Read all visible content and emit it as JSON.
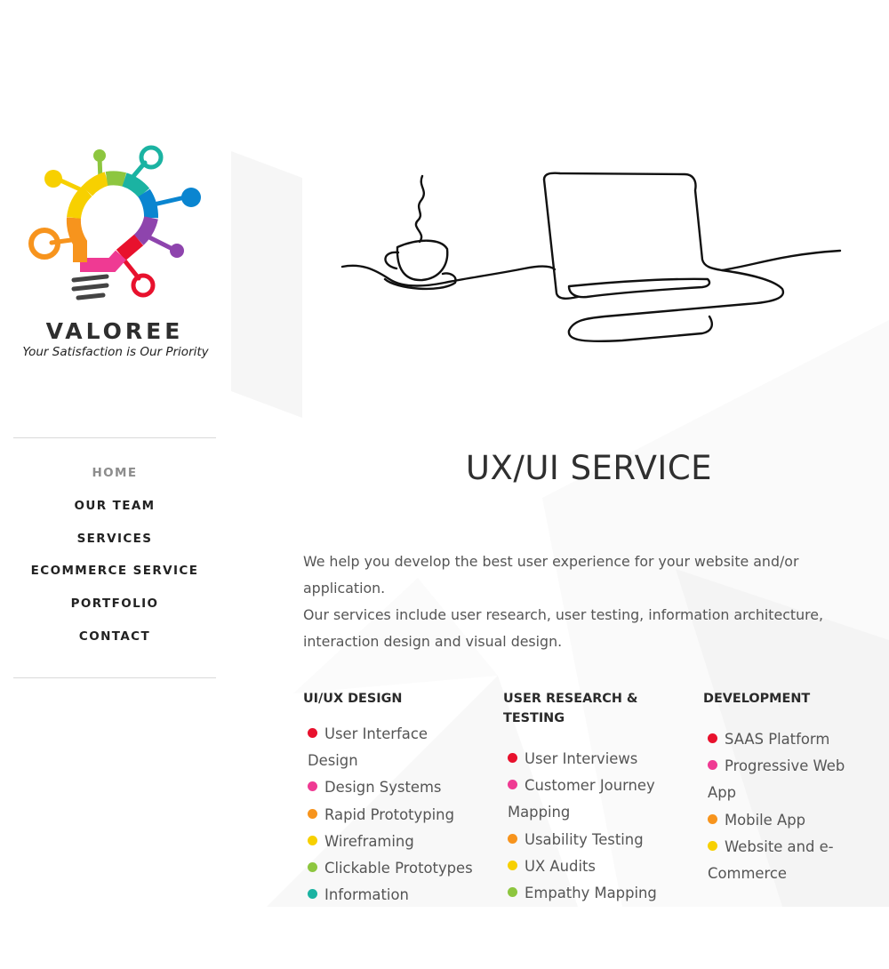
{
  "brand": {
    "name": "VALOREE",
    "tagline": "Your Satisfaction is Our Priority"
  },
  "nav": {
    "items": [
      "HOME",
      "OUR TEAM",
      "SERVICES",
      "ECOMMERCE SERVICE",
      "PORTFOLIO",
      "CONTACT"
    ],
    "active_index": 0
  },
  "main": {
    "title": "UX/UI SERVICE",
    "intro_lines": [
      "We help you develop the best user experience for your website and/or application.",
      "Our services include user research, user testing, information architecture,",
      "interaction design and visual design."
    ],
    "columns": [
      {
        "heading": "UI/UX DESIGN",
        "items": [
          {
            "text": "User Interface Design",
            "color": "#e8112d"
          },
          {
            "text": "Design Systems",
            "color": "#ef3a93"
          },
          {
            "text": "Rapid Prototyping",
            "color": "#f7941d"
          },
          {
            "text": "Wireframing",
            "color": "#f7d000"
          },
          {
            "text": "Clickable Prototypes",
            "color": "#8dc63f"
          },
          {
            "text": "Information",
            "color": "#1bb3a2"
          }
        ]
      },
      {
        "heading": "USER RESEARCH & TESTING",
        "items": [
          {
            "text": "User Interviews",
            "color": "#e8112d"
          },
          {
            "text": "Customer Journey Mapping",
            "color": "#ef3a93"
          },
          {
            "text": "Usability Testing",
            "color": "#f7941d"
          },
          {
            "text": "UX Audits",
            "color": "#f7d000"
          },
          {
            "text": "Empathy Mapping",
            "color": "#8dc63f"
          }
        ]
      },
      {
        "heading": "DEVELOPMENT",
        "items": [
          {
            "text": "SAAS Platform",
            "color": "#e8112d"
          },
          {
            "text": "Progressive Web App",
            "color": "#ef3a93"
          },
          {
            "text": "Mobile App",
            "color": "#f7941d"
          },
          {
            "text": "Website and e-Commerce",
            "color": "#f7d000"
          }
        ]
      }
    ]
  },
  "icons": {
    "logo": "lightbulb-network-logo",
    "hero": "coffee-laptop-line-art"
  }
}
